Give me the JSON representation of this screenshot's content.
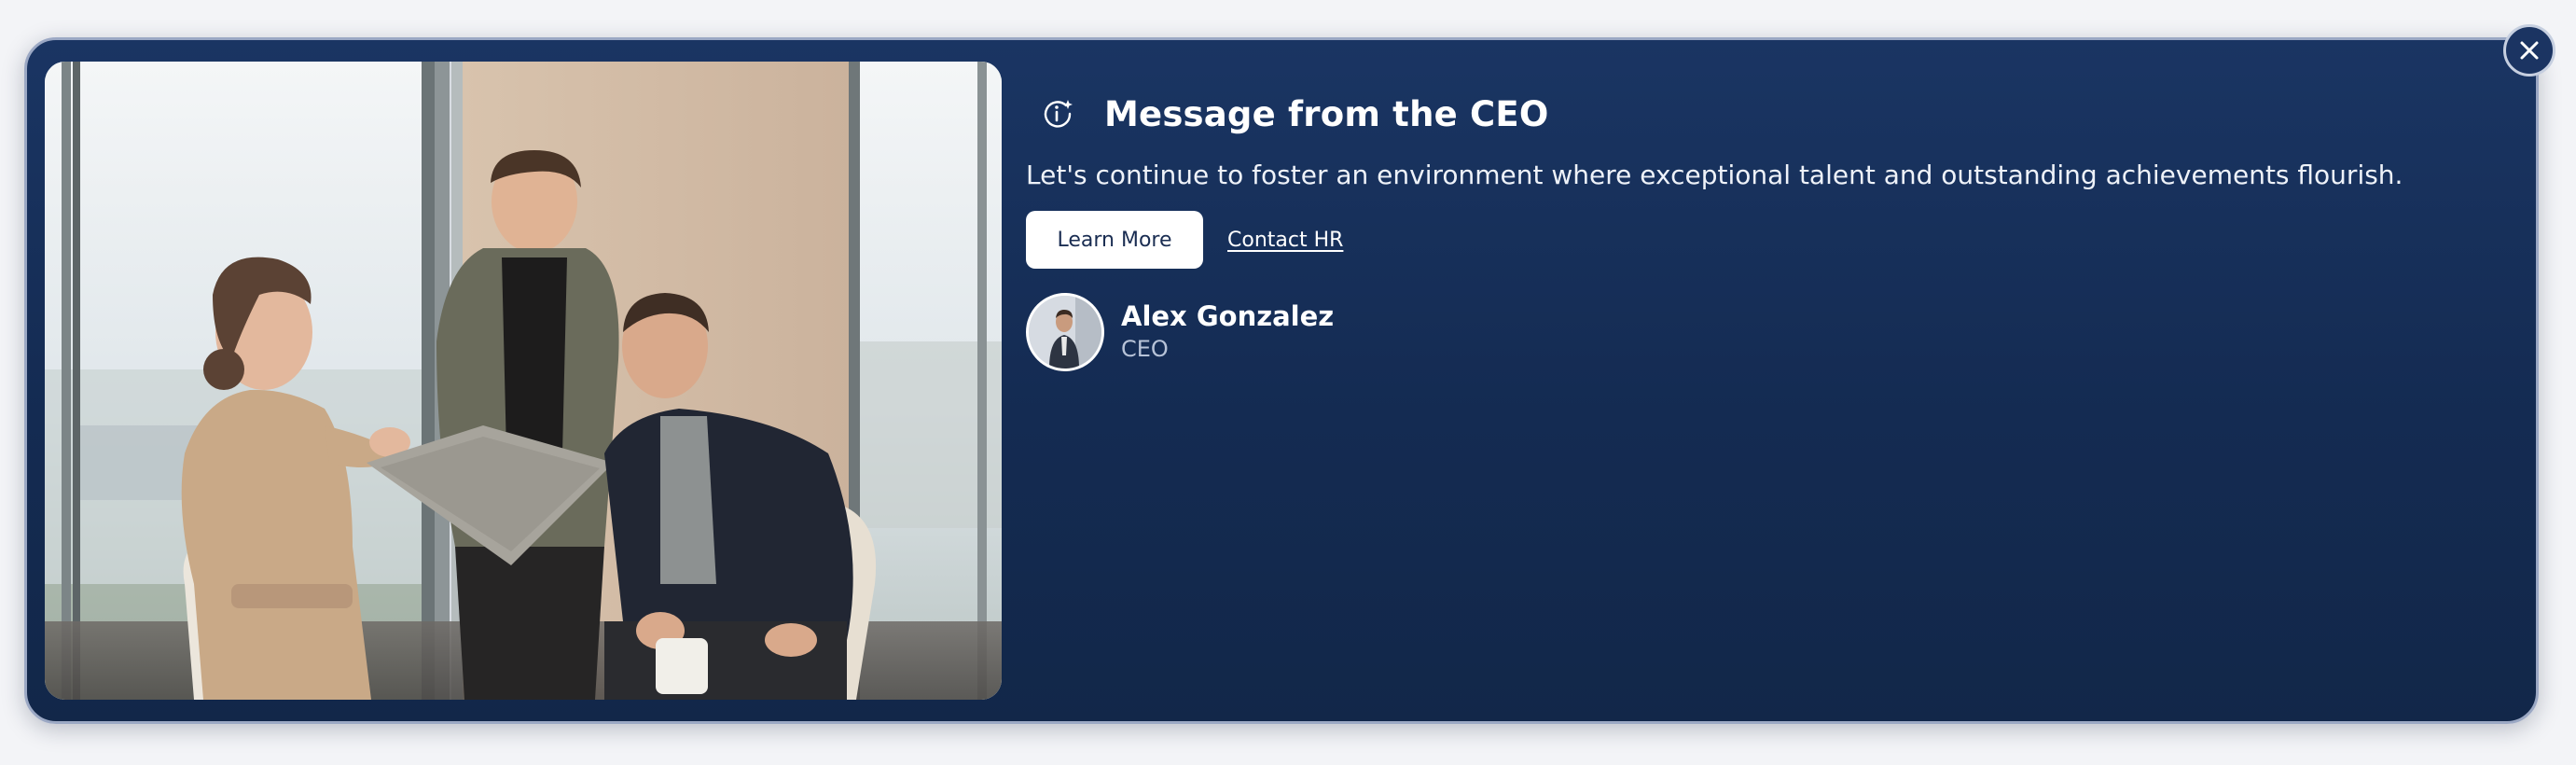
{
  "banner": {
    "title": "Message from the CEO",
    "title_icon": "info-sparkle-icon",
    "message": "Let's continue to foster an environment where exceptional talent and outstanding achievements flourish.",
    "primary_button_label": "Learn More",
    "link_label": "Contact HR",
    "close_icon": "close-icon"
  },
  "author": {
    "name": "Alex Gonzalez",
    "role": "CEO"
  },
  "colors": {
    "card_background": "#142b52",
    "card_border": "#9ba8c4",
    "button_background": "#ffffff",
    "button_text": "#1a2d52",
    "text_primary": "#ffffff",
    "text_secondary": "#b7c3d8"
  }
}
